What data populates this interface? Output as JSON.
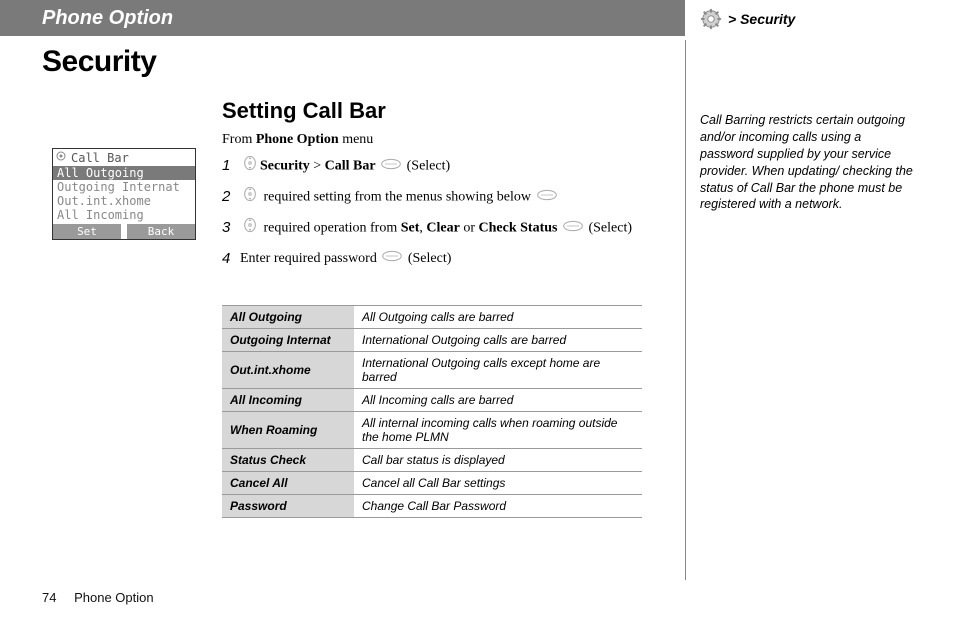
{
  "header": {
    "title": "Phone Option"
  },
  "breadcrumb": {
    "text": "> Security"
  },
  "page": {
    "heading": "Security",
    "subheading": "Setting Call Bar",
    "intro_prefix": "From ",
    "intro_bold": "Phone Option",
    "intro_suffix": " menu"
  },
  "steps": [
    {
      "num": "1",
      "parts": [
        "nav",
        [
          "b",
          "Security"
        ],
        " > ",
        [
          "b",
          "Call Bar"
        ],
        " ",
        "select",
        " (Select)"
      ]
    },
    {
      "num": "2",
      "parts": [
        "nav",
        " required setting from the menus showing below ",
        "select"
      ]
    },
    {
      "num": "3",
      "parts": [
        "nav",
        " required operation from ",
        [
          "b",
          "Set"
        ],
        ", ",
        [
          "b",
          "Clear"
        ],
        " or ",
        [
          "b",
          "Check Status"
        ],
        " ",
        "select",
        " (Select)"
      ]
    },
    {
      "num": "4",
      "parts": [
        "Enter required password ",
        "select",
        " (Select)"
      ]
    }
  ],
  "phone": {
    "title": "Call Bar",
    "items": [
      {
        "label": "All Outgoing",
        "selected": true
      },
      {
        "label": "Outgoing Internat",
        "selected": false
      },
      {
        "label": "Out.int.xhome",
        "selected": false
      },
      {
        "label": "All Incoming",
        "selected": false
      }
    ],
    "soft_left": "Set",
    "soft_right": "Back"
  },
  "table": [
    {
      "term": "All Outgoing",
      "desc": "All Outgoing calls are barred"
    },
    {
      "term": "Outgoing Internat",
      "desc": "International Outgoing calls are barred"
    },
    {
      "term": "Out.int.xhome",
      "desc": "International Outgoing calls except home are barred"
    },
    {
      "term": "All Incoming",
      "desc": "All Incoming calls are barred"
    },
    {
      "term": "When Roaming",
      "desc": "All internal incoming calls when roaming outside the home PLMN"
    },
    {
      "term": "Status Check",
      "desc": "Call bar status is displayed"
    },
    {
      "term": "Cancel All",
      "desc": "Cancel all Call Bar settings"
    },
    {
      "term": "Password",
      "desc": "Change Call Bar Password"
    }
  ],
  "sidebar_note": "Call Barring restricts certain outgoing and/or incoming calls using a password supplied by your service provider. When updating/ checking the status of Call Bar the phone must be registered with a network.",
  "footer": {
    "page": "74",
    "section": "Phone Option"
  }
}
